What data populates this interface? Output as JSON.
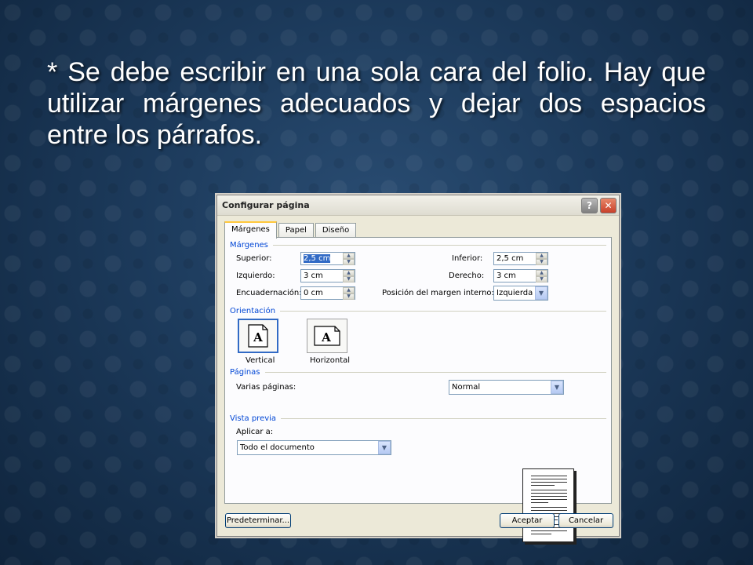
{
  "slide": {
    "text": "* Se debe escribir en una sola cara del folio. Hay que utilizar márgenes adecuados y dejar dos espacios entre los párrafos."
  },
  "dialog": {
    "title": "Configurar página",
    "help_glyph": "?",
    "close_glyph": "✕",
    "tabs": [
      {
        "label": "Márgenes",
        "active": true
      },
      {
        "label": "Papel",
        "active": false
      },
      {
        "label": "Diseño",
        "active": false
      }
    ],
    "margins": {
      "group_label": "Márgenes",
      "superior_label": "Superior:",
      "superior_value": "2,5 cm",
      "izquierdo_label": "Izquierdo:",
      "izquierdo_value": "3 cm",
      "encuadernacion_label": "Encuadernación:",
      "encuadernacion_value": "0 cm",
      "inferior_label": "Inferior:",
      "inferior_value": "2,5 cm",
      "derecho_label": "Derecho:",
      "derecho_value": "3 cm",
      "posicion_label": "Posición del margen interno:",
      "posicion_value": "Izquierda"
    },
    "orientation": {
      "group_label": "Orientación",
      "vertical_label": "Vertical",
      "horizontal_label": "Horizontal",
      "icon_letter": "A",
      "selected": "vertical"
    },
    "pages": {
      "group_label": "Páginas",
      "varias_label": "Varias páginas:",
      "varias_value": "Normal"
    },
    "preview": {
      "group_label": "Vista previa",
      "aplicar_label": "Aplicar a:",
      "aplicar_value": "Todo el documento"
    },
    "buttons": {
      "default_label": "Predeterminar...",
      "ok_label": "Aceptar",
      "cancel_label": "Cancelar"
    }
  },
  "colors": {
    "dialog_bg": "#ece9d8",
    "group_label": "#0046d5",
    "active_tab_accent": "#ffc83c"
  }
}
